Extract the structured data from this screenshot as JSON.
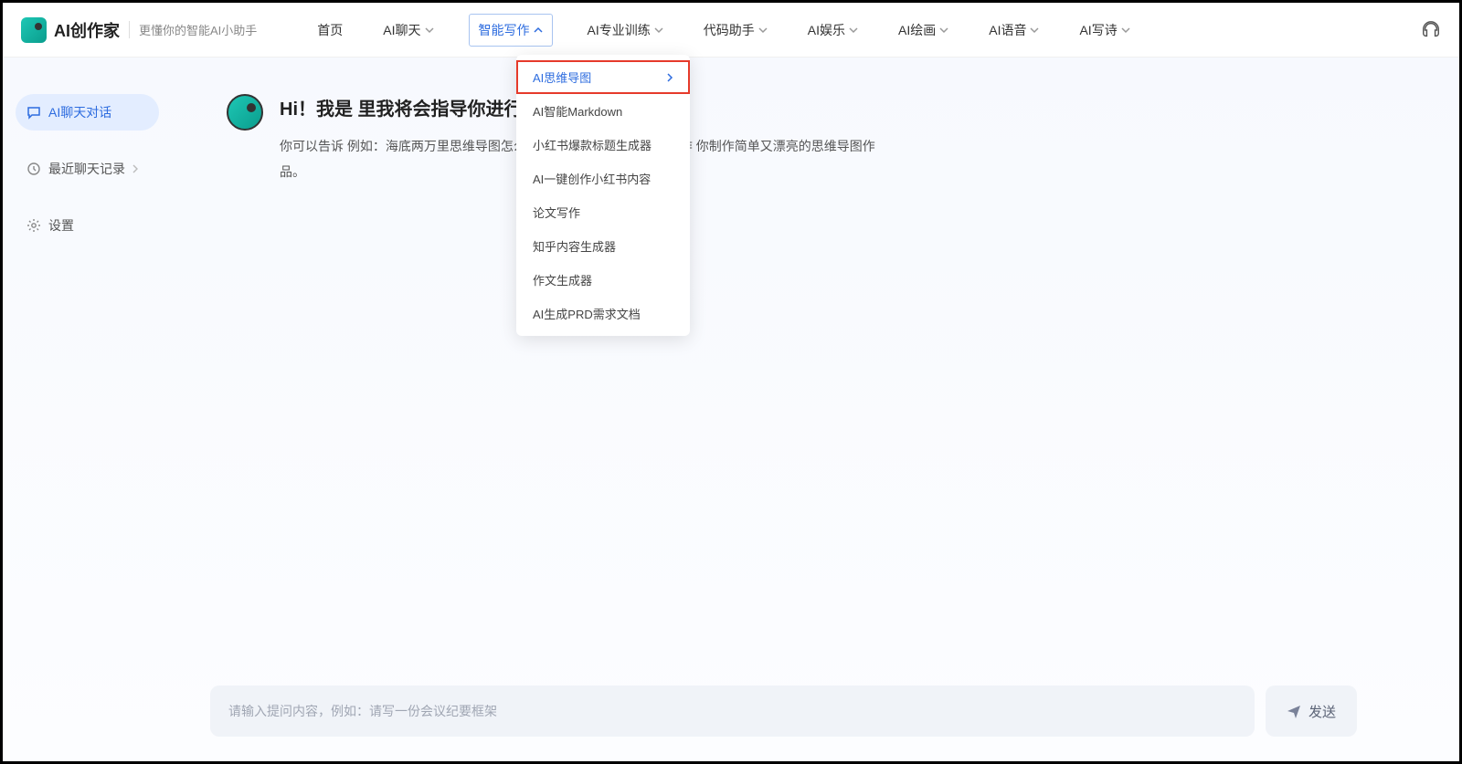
{
  "header": {
    "logo_text": "AI创作家",
    "tagline": "更懂你的智能AI小助手",
    "nav": [
      {
        "label": "首页",
        "has_dropdown": false
      },
      {
        "label": "AI聊天",
        "has_dropdown": true
      },
      {
        "label": "智能写作",
        "has_dropdown": true,
        "active": true
      },
      {
        "label": "AI专业训练",
        "has_dropdown": true
      },
      {
        "label": "代码助手",
        "has_dropdown": true
      },
      {
        "label": "AI娱乐",
        "has_dropdown": true
      },
      {
        "label": "AI绘画",
        "has_dropdown": true
      },
      {
        "label": "AI语音",
        "has_dropdown": true
      },
      {
        "label": "AI写诗",
        "has_dropdown": true
      }
    ]
  },
  "sidebar": {
    "items": [
      {
        "label": "AI聊天对话",
        "icon": "chat",
        "active": true
      },
      {
        "label": "最近聊天记录",
        "icon": "clock",
        "chevron": true
      },
      {
        "label": "设置",
        "icon": "gear"
      }
    ]
  },
  "dropdown": {
    "items": [
      {
        "label": "AI思维导图",
        "highlighted": true,
        "chevron": true
      },
      {
        "label": "AI智能Markdown"
      },
      {
        "label": "小红书爆款标题生成器"
      },
      {
        "label": "AI一键创作小红书内容"
      },
      {
        "label": "论文写作"
      },
      {
        "label": "知乎内容生成器"
      },
      {
        "label": "作文生成器"
      },
      {
        "label": "AI生成PRD需求文档"
      }
    ]
  },
  "welcome": {
    "title": "Hi！我是                              里我将会指导你进行思维导图制作~",
    "body": "你可以告诉                                           例如：海底两万里思维导图怎么画？我会为你准备好适合制作                                    你制作简单又漂亮的思维导图作品。"
  },
  "input": {
    "placeholder": "请输入提问内容，例如：请写一份会议纪要框架",
    "send_label": "发送"
  }
}
